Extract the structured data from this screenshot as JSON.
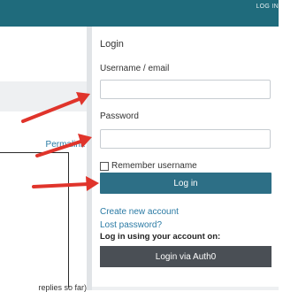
{
  "header": {
    "login_link": "LOG IN"
  },
  "left": {
    "permalink": "Permalink",
    "replies": "replies so far)"
  },
  "login": {
    "heading": "Login",
    "username_label": "Username / email",
    "username_value": "",
    "password_label": "Password",
    "password_value": "",
    "remember_label": "Remember username",
    "login_button": "Log in",
    "create_account": "Create new account",
    "lost_password": "Lost password?",
    "external_heading": "Log in using your account on:",
    "auth0_button": "Login via Auth0"
  },
  "colors": {
    "topbar": "#1f6b7c",
    "login_button": "#2d6f86",
    "auth_button": "#4a4f55",
    "arrow": "#e0342b",
    "link": "#2a7aa4"
  },
  "icons": [
    "checkbox-icon",
    "arrow-icon"
  ]
}
